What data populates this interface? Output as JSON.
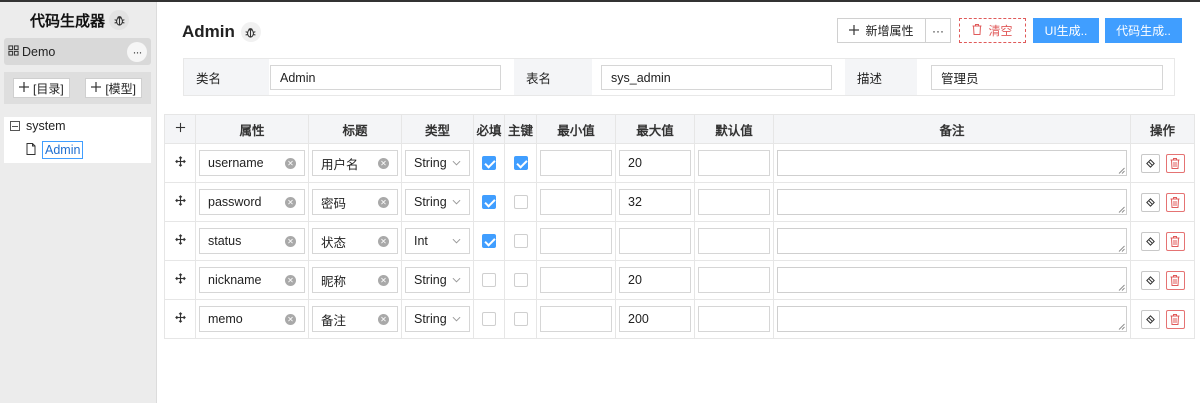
{
  "sidebar": {
    "app_title": "代码生成器",
    "project_name": "Demo",
    "more_label": "···",
    "add_directory_label": "[目录]",
    "add_model_label": "[模型]",
    "tree": {
      "folder": "system",
      "selected_item": "Admin"
    }
  },
  "header": {
    "title": "Admin",
    "add_property_label": "新增属性",
    "more_label": "···",
    "clear_label": "清空",
    "ui_gen_label": "UI生成..",
    "code_gen_label": "代码生成.."
  },
  "form": {
    "class_name_label": "类名",
    "class_name_value": "Admin",
    "table_name_label": "表名",
    "table_name_value": "sys_admin",
    "description_label": "描述",
    "description_value": "管理员"
  },
  "table": {
    "headers": [
      "属性",
      "标题",
      "类型",
      "必填",
      "主键",
      "最小值",
      "最大值",
      "默认值",
      "备注",
      "操作"
    ],
    "rows": [
      {
        "name": "username",
        "title": "用户名",
        "type": "String",
        "required": true,
        "primary_key": true,
        "min": "",
        "max": "20",
        "default": "",
        "memo": ""
      },
      {
        "name": "password",
        "title": "密码",
        "type": "String",
        "required": true,
        "primary_key": false,
        "min": "",
        "max": "32",
        "default": "",
        "memo": ""
      },
      {
        "name": "status",
        "title": "状态",
        "type": "Int",
        "required": true,
        "primary_key": false,
        "min": "",
        "max": "",
        "default": "",
        "memo": ""
      },
      {
        "name": "nickname",
        "title": "昵称",
        "type": "String",
        "required": false,
        "primary_key": false,
        "min": "",
        "max": "20",
        "default": "",
        "memo": ""
      },
      {
        "name": "memo",
        "title": "备注",
        "type": "String",
        "required": false,
        "primary_key": false,
        "min": "",
        "max": "200",
        "default": "",
        "memo": ""
      }
    ]
  },
  "colors": {
    "primary": "#409eff",
    "danger": "#e05a5a",
    "sidebar_bg": "#ececec",
    "header_bg": "#f4f5f7"
  },
  "icons": {
    "title_badge": "bug-icon",
    "project": "model-tree-icon",
    "add": "plus-icon",
    "tree_toggle": "minus-square-icon",
    "tree_item": "file-icon",
    "clear": "trash-icon",
    "row_drag": "move-icon",
    "input_clear": "clear-x-icon",
    "select": "chevron-down-icon",
    "row_copy": "copy-icon",
    "row_delete": "delete-icon"
  }
}
